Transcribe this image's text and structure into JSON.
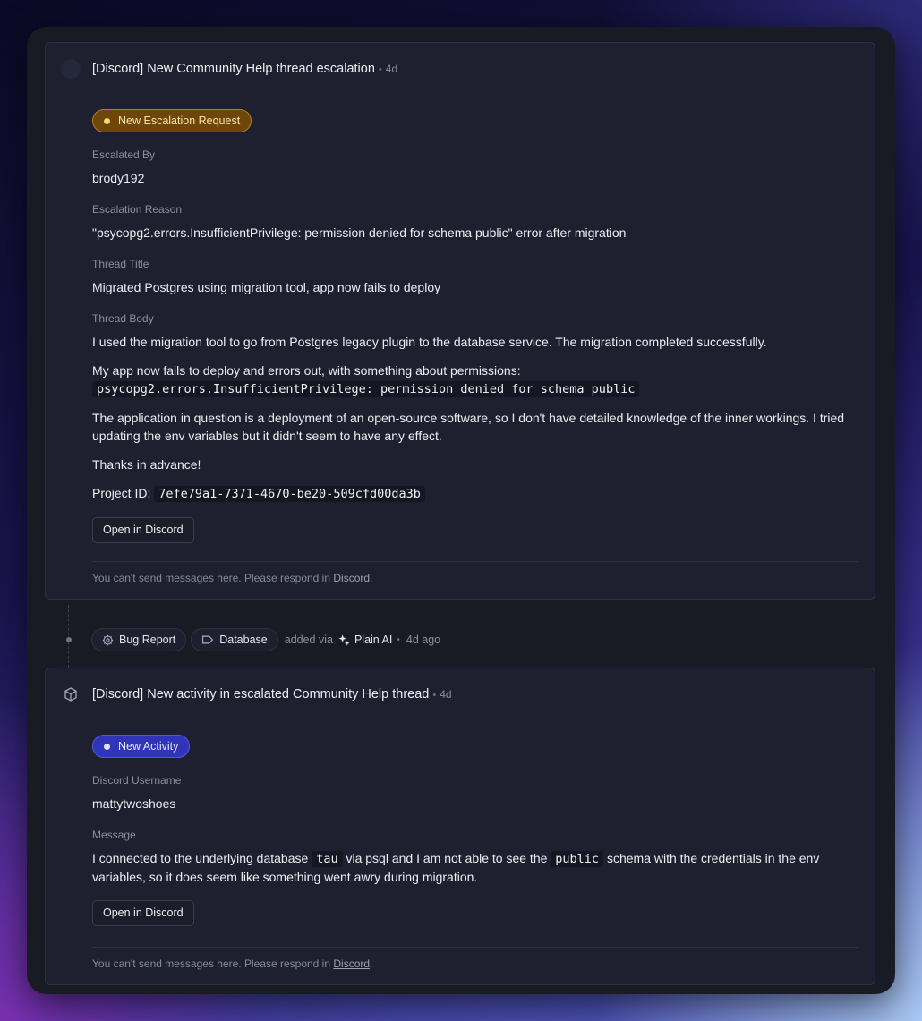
{
  "card1": {
    "title": "[Discord] New Community Help thread escalation",
    "age": "4d",
    "badge": "New Escalation Request",
    "fields": {
      "escalated_by_label": "Escalated By",
      "escalated_by": "brody192",
      "reason_label": "Escalation Reason",
      "reason": "\"psycopg2.errors.InsufficientPrivilege: permission denied for schema public\" error after migration",
      "thread_title_label": "Thread Title",
      "thread_title": "Migrated Postgres using migration tool, app now fails to deploy",
      "thread_body_label": "Thread Body"
    },
    "body": {
      "p1": "I used the migration tool to go from Postgres legacy plugin to the database service. The migration completed successfully.",
      "p2": "My app now fails to deploy and errors out, with something about permissions:",
      "p2_code": "psycopg2.errors.InsufficientPrivilege: permission denied for schema public",
      "p3": "The application in question is a deployment of an open-source software, so I don't have detailed knowledge of the inner workings. I tried updating the env variables but it didn't seem to have any effect.",
      "p4": "Thanks in advance!",
      "p5_label": "Project ID:",
      "p5_code": "7efe79a1-7371-4670-be20-509cfd00da3b"
    },
    "button": "Open in Discord",
    "footer_text": "You can't send messages here. Please respond in",
    "footer_link": "Discord",
    "footer_end": "."
  },
  "event": {
    "label1": "Bug Report",
    "label2": "Database",
    "added_via": "added via",
    "ai_name": "Plain AI",
    "age": "4d ago"
  },
  "card2": {
    "title": "[Discord] New activity in escalated Community Help thread",
    "age": "4d",
    "badge": "New Activity",
    "username_label": "Discord Username",
    "username": "mattytwoshoes",
    "message_label": "Message",
    "message_a": "I connected to the underlying database",
    "message_code1": "tau",
    "message_b": "via psql and I am not able to see the",
    "message_code2": "public",
    "message_c": "schema with the credentials in the env variables, so it does seem like something went awry during migration.",
    "button": "Open in Discord",
    "footer_text": "You can't send messages here. Please respond in",
    "footer_link": "Discord",
    "footer_end": "."
  },
  "colors": {
    "amber_badge": "#6e4608",
    "blue_badge": "#3034b8",
    "card_bg": "#1e2030"
  },
  "icons": {
    "card1": "collapse-icon",
    "card2": "cube-icon",
    "bug": "bug-icon",
    "tag": "tag-icon",
    "ai": "sparkles-icon"
  }
}
